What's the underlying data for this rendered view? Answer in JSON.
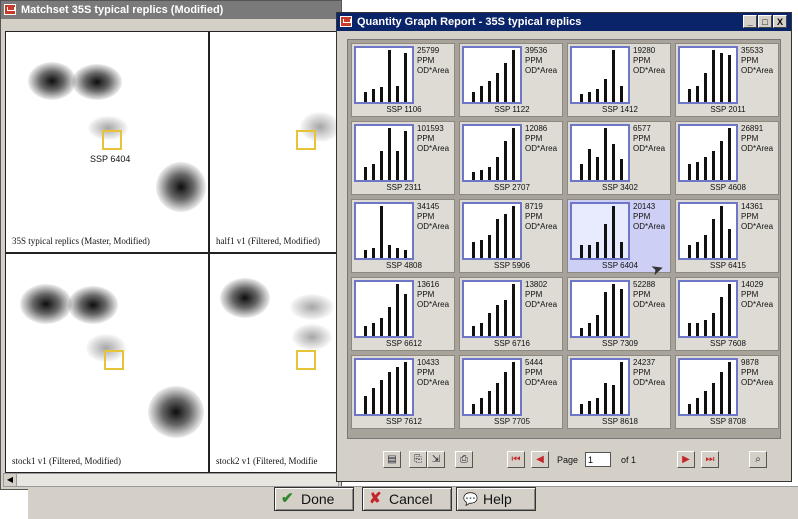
{
  "matchset": {
    "title": "Matchset 35S typical replics (Modified)",
    "panels": [
      {
        "caption": "35S typical replics (Master, Modified)",
        "spot_label": "SSP 6404"
      },
      {
        "caption": "half1 v1 (Filtered, Modified)"
      },
      {
        "caption": "stock1 v1 (Filtered, Modified)"
      },
      {
        "caption": "stock2 v1 (Filtered, Modifie"
      }
    ],
    "scroll_icon": "left-arrow-icon"
  },
  "dialog_buttons": {
    "done": "Done",
    "cancel": "Cancel",
    "help": "Help",
    "done_icon": "✔",
    "cancel_icon": "✘",
    "help_icon": "💬"
  },
  "report": {
    "title": "Quantity Graph Report - 35S typical replics",
    "window_controls": [
      "_",
      "□",
      "X"
    ],
    "unit_line1": "PPM",
    "unit_line2": "OD*Area",
    "tiles": [
      {
        "spot": "SSP 1106",
        "value": "25799",
        "bars": [
          0.2,
          0.25,
          0.28,
          1.0,
          0.3,
          0.95
        ]
      },
      {
        "spot": "SSP 1122",
        "value": "39536",
        "bars": [
          0.2,
          0.3,
          0.4,
          0.55,
          0.75,
          1.0
        ]
      },
      {
        "spot": "SSP 1412",
        "value": "19280",
        "bars": [
          0.15,
          0.2,
          0.25,
          0.45,
          1.0,
          0.3
        ]
      },
      {
        "spot": "SSP 2011",
        "value": "35533",
        "bars": [
          0.25,
          0.3,
          0.55,
          1.0,
          0.95,
          0.9
        ]
      },
      {
        "spot": "SSP 2311",
        "value": "101593",
        "bars": [
          0.25,
          0.3,
          0.55,
          1.0,
          0.55,
          0.95
        ]
      },
      {
        "spot": "SSP 2707",
        "value": "12086",
        "bars": [
          0.15,
          0.2,
          0.25,
          0.45,
          0.75,
          1.0
        ]
      },
      {
        "spot": "SSP 3402",
        "value": "6577",
        "bars": [
          0.3,
          0.6,
          0.45,
          1.0,
          0.7,
          0.4
        ]
      },
      {
        "spot": "SSP 4608",
        "value": "26891",
        "bars": [
          0.3,
          0.35,
          0.45,
          0.55,
          0.75,
          1.0
        ]
      },
      {
        "spot": "SSP 4808",
        "value": "34145",
        "bars": [
          0.15,
          0.2,
          1.0,
          0.25,
          0.2,
          0.15
        ]
      },
      {
        "spot": "SSP 5906",
        "value": "8719",
        "bars": [
          0.3,
          0.35,
          0.45,
          0.75,
          0.85,
          1.0
        ]
      },
      {
        "spot": "SSP 6404",
        "value": "20143",
        "selected": true,
        "bars": [
          0.25,
          0.25,
          0.3,
          0.65,
          1.0,
          0.3
        ]
      },
      {
        "spot": "SSP 6415",
        "value": "14361",
        "bars": [
          0.25,
          0.3,
          0.45,
          0.75,
          1.0,
          0.55
        ]
      },
      {
        "spot": "SSP 6612",
        "value": "13616",
        "bars": [
          0.2,
          0.25,
          0.35,
          0.55,
          1.0,
          0.8
        ]
      },
      {
        "spot": "SSP 6716",
        "value": "13802",
        "bars": [
          0.2,
          0.25,
          0.45,
          0.6,
          0.7,
          1.0
        ]
      },
      {
        "spot": "SSP 7309",
        "value": "52288",
        "bars": [
          0.15,
          0.25,
          0.4,
          0.85,
          1.0,
          0.9
        ]
      },
      {
        "spot": "SSP 7608",
        "value": "14029",
        "bars": [
          0.25,
          0.25,
          0.3,
          0.45,
          0.75,
          1.0
        ]
      },
      {
        "spot": "SSP 7612",
        "value": "10433",
        "bars": [
          0.35,
          0.5,
          0.65,
          0.8,
          0.9,
          1.0
        ]
      },
      {
        "spot": "SSP 7705",
        "value": "5444",
        "bars": [
          0.2,
          0.3,
          0.45,
          0.6,
          0.8,
          1.0
        ]
      },
      {
        "spot": "SSP 8618",
        "value": "24237",
        "bars": [
          0.2,
          0.25,
          0.3,
          0.6,
          0.55,
          1.0
        ]
      },
      {
        "spot": "SSP 8708",
        "value": "9878",
        "bars": [
          0.2,
          0.3,
          0.45,
          0.6,
          0.8,
          1.0
        ]
      }
    ],
    "toolbar": {
      "page_label": "Page",
      "page_value": "1",
      "of_label": "of 1",
      "icons": [
        "book-icon",
        "print-preview-icon",
        "export-icon",
        "print-icon",
        "first-page-icon",
        "previous-page-icon",
        "next-page-icon",
        "last-page-icon",
        "zoom-icon"
      ]
    }
  },
  "colors": {
    "active_title": "#0a246a",
    "inactive_title": "#7a7a7a",
    "selection_box": "#e8c33a",
    "selected_tile": "#cdd0f4"
  }
}
